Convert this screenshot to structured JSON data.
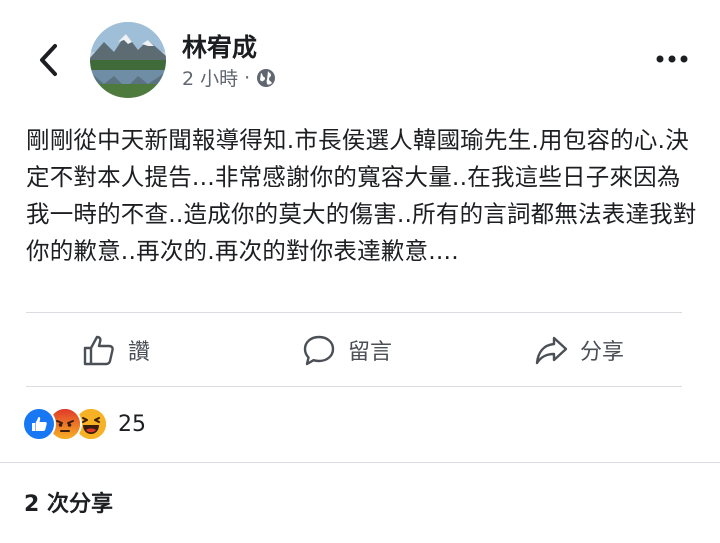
{
  "post": {
    "author": "林宥成",
    "time": "2 小時",
    "separator": "·",
    "privacy_icon": "globe-icon",
    "text": "剛剛從中天新聞報導得知.市長侯選人韓國瑜先生.用包容的心.決定不對本人提告...非常感謝你的寬容大量..在我這些日子來因為我一時的不查..造成你的莫大的傷害..所有的言詞都無法表達我對你的歉意..再次的.再次的對你表達歉意...."
  },
  "actions": {
    "like": {
      "label": "讚",
      "icon": "thumbs-up-icon"
    },
    "comment": {
      "label": "留言",
      "icon": "comment-icon"
    },
    "share": {
      "label": "分享",
      "icon": "share-arrow-icon"
    }
  },
  "reactions": {
    "icons": [
      "like-reaction-icon",
      "angry-reaction-icon",
      "haha-reaction-icon"
    ],
    "count": "25"
  },
  "shares": {
    "label": "2 次分享"
  },
  "colors": {
    "like_blue": "#1877f2",
    "angry_orange": "#e9710f",
    "haha_yellow": "#f7b125",
    "text": "#1c1e21",
    "meta": "#606770"
  }
}
